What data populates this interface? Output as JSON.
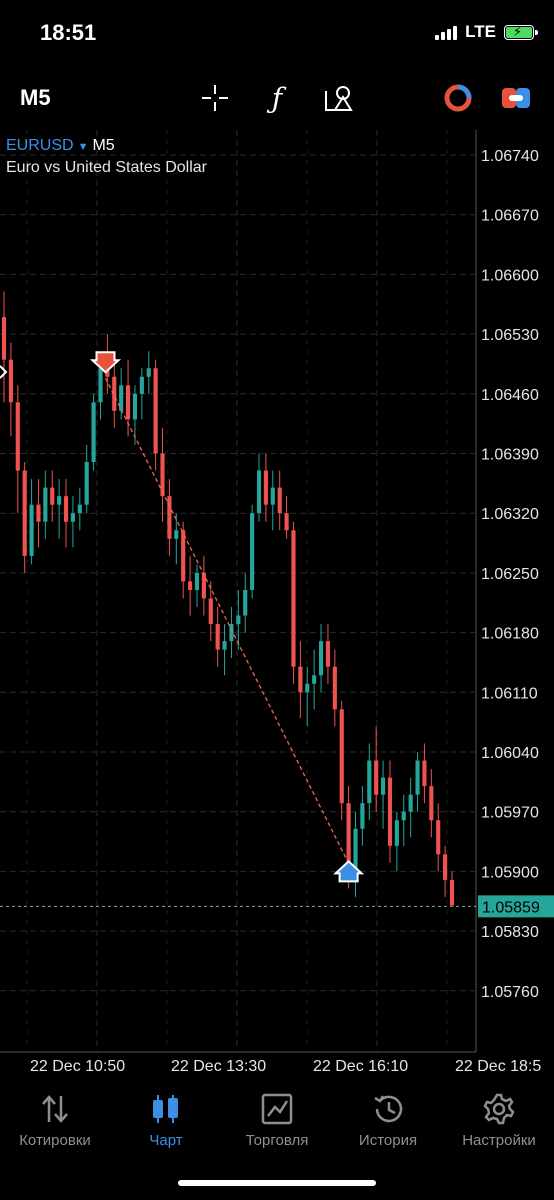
{
  "status": {
    "time": "18:51",
    "network": "LTE",
    "battery_color": "#4cd964"
  },
  "toolbar": {
    "timeframe": "M5",
    "tools": [
      "crosshair-icon",
      "indicators-icon",
      "objects-icon",
      "trade-icon",
      "account-icon"
    ]
  },
  "chart": {
    "symbol": "EURUSD",
    "timeframe": "M5",
    "description": "Euro vs United States Dollar",
    "current_price_label": "1.05859",
    "price_axis": [
      "1.06740",
      "1.06670",
      "1.06600",
      "1.06530",
      "1.06460",
      "1.06390",
      "1.06320",
      "1.06250",
      "1.06180",
      "1.06110",
      "1.06040",
      "1.05970",
      "1.05900",
      "1.05830",
      "1.05760"
    ],
    "time_axis": [
      "22 Dec 10:50",
      "22 Dec 13:30",
      "22 Dec 16:10",
      "22 Dec 18:5"
    ]
  },
  "chart_data": {
    "type": "candlestick",
    "symbol": "EURUSD",
    "ylim": [
      1.057,
      1.0678
    ],
    "current_price": 1.05859,
    "bull_color": "#26a69a",
    "bear_color": "#ef5350",
    "grid": true,
    "candles": [
      [
        1.0655,
        1.0658,
        1.0645,
        1.065
      ],
      [
        1.065,
        1.0652,
        1.0641,
        1.0645
      ],
      [
        1.0645,
        1.0647,
        1.0632,
        1.0637
      ],
      [
        1.0637,
        1.0638,
        1.0625,
        1.0627
      ],
      [
        1.0627,
        1.0636,
        1.0626,
        1.0633
      ],
      [
        1.0633,
        1.0636,
        1.0628,
        1.0631
      ],
      [
        1.0631,
        1.0637,
        1.0629,
        1.0635
      ],
      [
        1.0635,
        1.0637,
        1.0631,
        1.0633
      ],
      [
        1.0633,
        1.0636,
        1.0629,
        1.0634
      ],
      [
        1.0634,
        1.0636,
        1.0628,
        1.0631
      ],
      [
        1.0631,
        1.0634,
        1.0628,
        1.0632
      ],
      [
        1.0632,
        1.0635,
        1.063,
        1.0633
      ],
      [
        1.0633,
        1.064,
        1.0632,
        1.0638
      ],
      [
        1.0638,
        1.0646,
        1.0637,
        1.0645
      ],
      [
        1.0645,
        1.065,
        1.0643,
        1.0649
      ],
      [
        1.0649,
        1.0653,
        1.0646,
        1.0648
      ],
      [
        1.0648,
        1.065,
        1.0642,
        1.0644
      ],
      [
        1.0644,
        1.0649,
        1.0643,
        1.0647
      ],
      [
        1.0647,
        1.065,
        1.0641,
        1.0643
      ],
      [
        1.0643,
        1.0647,
        1.064,
        1.0646
      ],
      [
        1.0646,
        1.0649,
        1.0643,
        1.0648
      ],
      [
        1.0648,
        1.0651,
        1.0646,
        1.0649
      ],
      [
        1.0649,
        1.065,
        1.0637,
        1.0639
      ],
      [
        1.0639,
        1.0642,
        1.0631,
        1.0634
      ],
      [
        1.0634,
        1.0636,
        1.0627,
        1.0629
      ],
      [
        1.0629,
        1.0632,
        1.0626,
        1.063
      ],
      [
        1.063,
        1.0631,
        1.0622,
        1.0624
      ],
      [
        1.0624,
        1.0627,
        1.062,
        1.0623
      ],
      [
        1.0623,
        1.0626,
        1.0621,
        1.0625
      ],
      [
        1.0625,
        1.0627,
        1.062,
        1.0622
      ],
      [
        1.0622,
        1.0624,
        1.0617,
        1.0619
      ],
      [
        1.0619,
        1.0621,
        1.0614,
        1.0616
      ],
      [
        1.0616,
        1.0619,
        1.0613,
        1.0617
      ],
      [
        1.0617,
        1.0621,
        1.0615,
        1.0619
      ],
      [
        1.0619,
        1.0623,
        1.0616,
        1.062
      ],
      [
        1.062,
        1.0625,
        1.0618,
        1.0623
      ],
      [
        1.0623,
        1.0633,
        1.0622,
        1.0632
      ],
      [
        1.0632,
        1.0639,
        1.0631,
        1.0637
      ],
      [
        1.0637,
        1.0639,
        1.0631,
        1.0633
      ],
      [
        1.0633,
        1.0637,
        1.063,
        1.0635
      ],
      [
        1.0635,
        1.0637,
        1.063,
        1.0632
      ],
      [
        1.0632,
        1.0634,
        1.0629,
        1.063
      ],
      [
        1.063,
        1.0631,
        1.0612,
        1.0614
      ],
      [
        1.0614,
        1.0617,
        1.0608,
        1.0611
      ],
      [
        1.0611,
        1.0614,
        1.0607,
        1.0612
      ],
      [
        1.0612,
        1.0616,
        1.0609,
        1.0613
      ],
      [
        1.0613,
        1.0619,
        1.0611,
        1.0617
      ],
      [
        1.0617,
        1.0619,
        1.0612,
        1.0614
      ],
      [
        1.0614,
        1.0616,
        1.0607,
        1.0609
      ],
      [
        1.0609,
        1.061,
        1.0596,
        1.0598
      ],
      [
        1.0598,
        1.06,
        1.0588,
        1.059
      ],
      [
        1.059,
        1.0597,
        1.0587,
        1.0595
      ],
      [
        1.0595,
        1.06,
        1.0593,
        1.0598
      ],
      [
        1.0598,
        1.0605,
        1.0596,
        1.0603
      ],
      [
        1.0603,
        1.0607,
        1.0597,
        1.0599
      ],
      [
        1.0599,
        1.0603,
        1.0595,
        1.0601
      ],
      [
        1.0601,
        1.0603,
        1.0591,
        1.0593
      ],
      [
        1.0593,
        1.0597,
        1.059,
        1.0596
      ],
      [
        1.0596,
        1.0599,
        1.0593,
        1.0597
      ],
      [
        1.0597,
        1.0601,
        1.0594,
        1.0599
      ],
      [
        1.0599,
        1.0604,
        1.0597,
        1.0603
      ],
      [
        1.0603,
        1.0605,
        1.0598,
        1.06
      ],
      [
        1.06,
        1.0602,
        1.0594,
        1.0596
      ],
      [
        1.0596,
        1.0598,
        1.059,
        1.0592
      ],
      [
        1.0592,
        1.0593,
        1.0587,
        1.0589
      ],
      [
        1.0589,
        1.059,
        1.0586,
        1.0586
      ]
    ],
    "markers": [
      {
        "type": "sell",
        "index": 14,
        "price": 1.0649
      },
      {
        "type": "buy",
        "index": 50,
        "price": 1.059
      }
    ]
  },
  "tabbar": {
    "active": 1,
    "items": [
      {
        "label": "Котировки",
        "icon": "quotes-arrows-icon"
      },
      {
        "label": "Чарт",
        "icon": "candles-icon"
      },
      {
        "label": "Торговля",
        "icon": "trade-chart-icon"
      },
      {
        "label": "История",
        "icon": "history-clock-icon"
      },
      {
        "label": "Настройки",
        "icon": "settings-gear-icon"
      }
    ]
  }
}
